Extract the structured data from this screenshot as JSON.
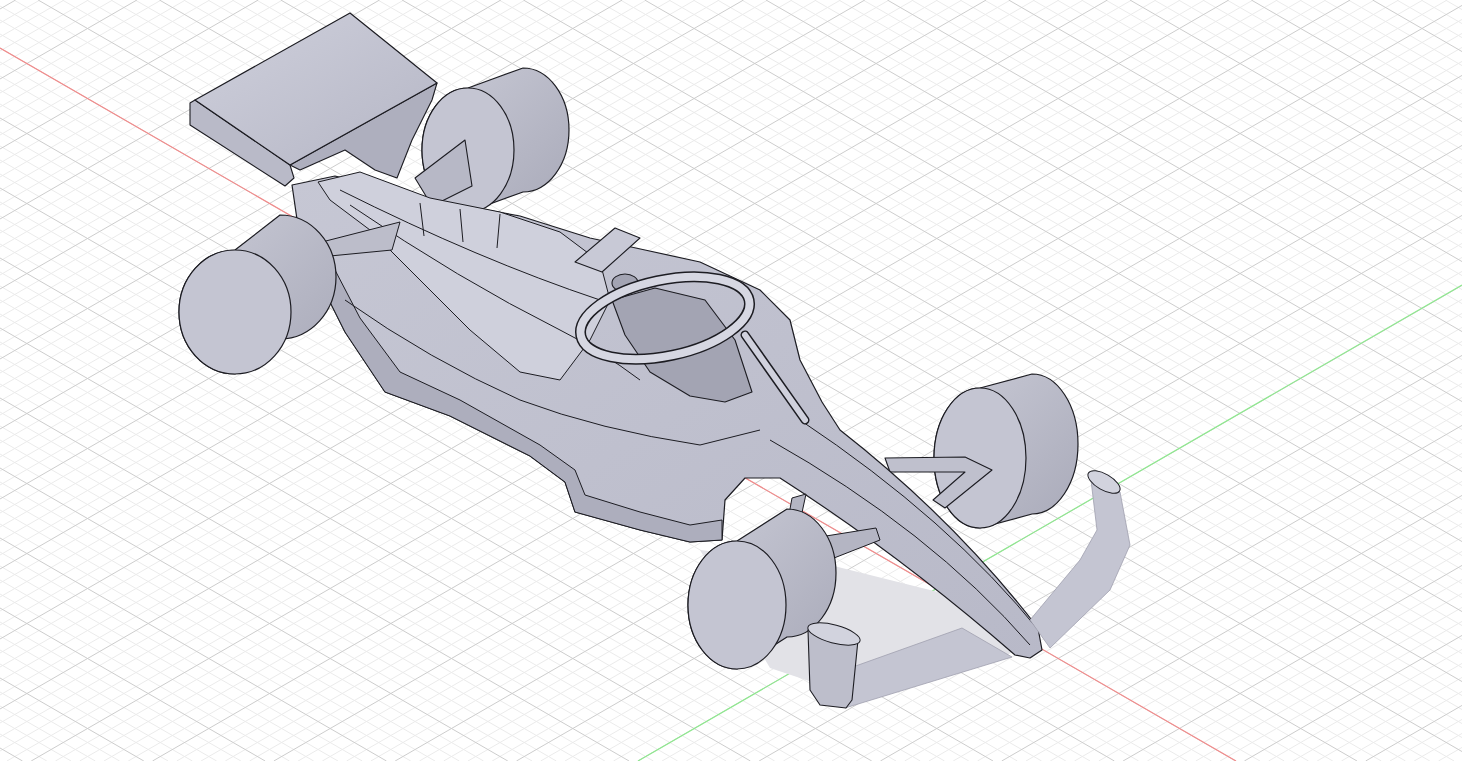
{
  "viewport": {
    "axes": [
      {
        "kind": "x",
        "color": "#f28b8b"
      },
      {
        "kind": "y",
        "color": "#8fe88f"
      }
    ]
  }
}
